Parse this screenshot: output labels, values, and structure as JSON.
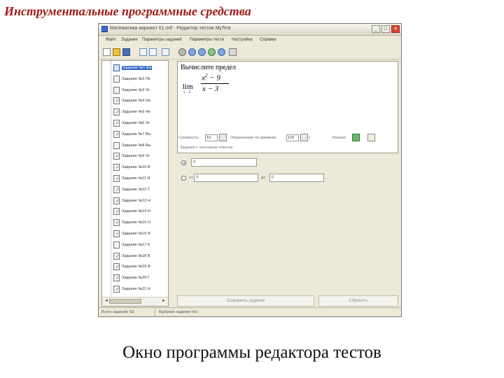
{
  "slide": {
    "title": "Инструментальные программные средства",
    "caption": "Окно программы редактора тестов"
  },
  "window": {
    "title": "Математика вариант 01.mtf - Редактор тестов MyTest",
    "controls": {
      "minimize": "_",
      "maximize": "□",
      "close": "×"
    }
  },
  "menu": [
    "Файл",
    "Задание",
    "Параметры заданий",
    "Параметры теста",
    "Настройка",
    "Справка"
  ],
  "toolbar": {
    "buttons": [
      "new-file-icon",
      "open-file-icon",
      "save-file-icon",
      "add-task-icon",
      "add-question-icon",
      "insert-icon",
      "settings-icon",
      "arrow-left-icon",
      "arrow-right-icon",
      "test-options-icon",
      "copy-icon",
      "paste-icon"
    ]
  },
  "tree": {
    "items": [
      {
        "label": "Задание №1 Вы",
        "selected": true,
        "checked": false
      },
      {
        "label": "Задание №2 Пе",
        "selected": false,
        "checked": false
      },
      {
        "label": "Задание №3 Ук",
        "selected": false,
        "checked": false
      },
      {
        "label": "Задание №4 На",
        "selected": false,
        "checked": true
      },
      {
        "label": "Задание №5 Не",
        "selected": false,
        "checked": true
      },
      {
        "label": "Задание №6 Ук",
        "selected": false,
        "checked": true
      },
      {
        "label": "Задание №7 Вы",
        "selected": false,
        "checked": true
      },
      {
        "label": "Задание №8 Вы",
        "selected": false,
        "checked": false
      },
      {
        "label": "Задание №9 Ук",
        "selected": false,
        "checked": true
      },
      {
        "label": "Задание №10 В",
        "selected": false,
        "checked": true
      },
      {
        "label": "Задание №11 Н",
        "selected": false,
        "checked": true
      },
      {
        "label": "Задание №12 Т",
        "selected": false,
        "checked": true
      },
      {
        "label": "Задание №13 Н",
        "selected": false,
        "checked": true
      },
      {
        "label": "Задание №14 Н",
        "selected": false,
        "checked": true
      },
      {
        "label": "Задание №15 Н",
        "selected": false,
        "checked": true
      },
      {
        "label": "Задание №16 Ф",
        "selected": false,
        "checked": true
      },
      {
        "label": "Задание №17 К",
        "selected": false,
        "checked": false
      },
      {
        "label": "Задание №18 В",
        "selected": false,
        "checked": true
      },
      {
        "label": "Задание №19 Ф",
        "selected": false,
        "checked": true
      },
      {
        "label": "Задание №20 Г",
        "selected": false,
        "checked": true
      },
      {
        "label": "Задание №21 Н",
        "selected": false,
        "checked": true
      },
      {
        "label": "Задание №22 П",
        "selected": false,
        "checked": true
      }
    ],
    "scroll_left": "◄",
    "scroll_right": "►"
  },
  "editor": {
    "question": "Вычислите предел",
    "lim": "lim",
    "lim_sub": "x→3",
    "numerator_base": "x",
    "numerator_exp": "2",
    "numerator_rest": " − 9",
    "denominator": "x − 3"
  },
  "options": {
    "difficulty_label": "Сложность:",
    "difficulty_value": "10",
    "time_label": "Ограничение по времени:",
    "time_value": "120",
    "time_unit": "с",
    "answer_label": "Разное:"
  },
  "answers": {
    "section_title": "Задание с числовым ответом",
    "exact_value": "0",
    "range_from_label": "от",
    "range_from_value": "0",
    "range_to_label": "до",
    "range_to_value": "0"
  },
  "buttons": {
    "save_task": "Сохранить задание",
    "reset": "Сбросить"
  },
  "status": {
    "total": "Всего заданий: 53",
    "current": "Выбрано задание №1"
  }
}
